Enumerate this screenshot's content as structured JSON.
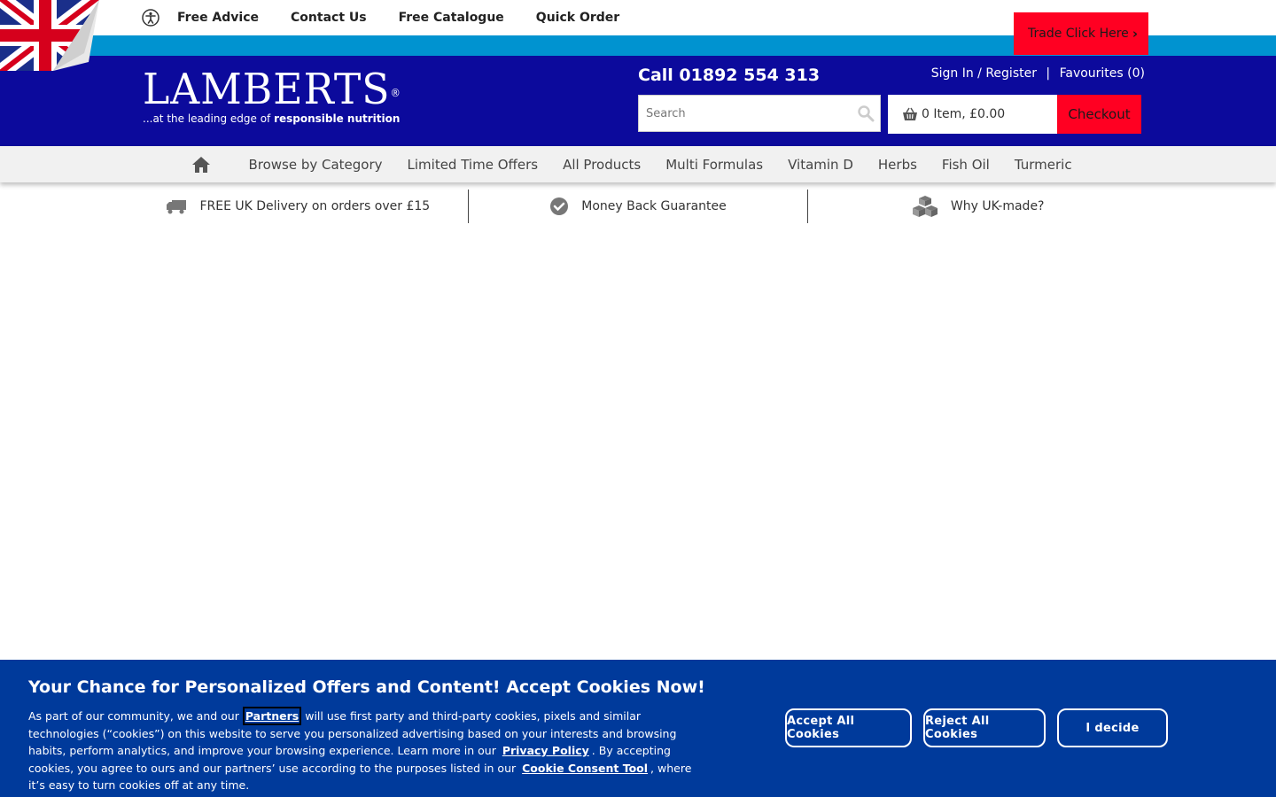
{
  "topnav": {
    "items": [
      "Free Advice",
      "Contact Us",
      "Free Catalogue",
      "Quick Order"
    ],
    "trade_label": "Trade Click Here"
  },
  "header": {
    "logo_word": "LAMBERTS",
    "logo_mark": "®",
    "logo_tag_prefix": "...at the leading edge of ",
    "logo_tag_bold": "responsible nutrition",
    "phone": "Call 01892 554 313",
    "sign_in": "Sign In / Register",
    "separator": "|",
    "favourites": "Favourites (0)",
    "search_placeholder": "Search",
    "basket": "0 Item, £0.00",
    "checkout": "Checkout"
  },
  "mainnav": {
    "items": [
      "Browse by Category",
      "Limited Time Offers",
      "All Products",
      "Multi Formulas",
      "Vitamin D",
      "Herbs",
      "Fish Oil",
      "Turmeric"
    ]
  },
  "benefits": [
    "FREE UK Delivery on orders over £15",
    "Money Back Guarantee",
    "Why UK-made?"
  ],
  "cookie": {
    "title": "Your Chance for Personalized Offers and Content! Accept Cookies Now! ",
    "text_1": "As part of our community, we and our ",
    "partners_link": "Partners",
    "text_2": " will use first party and third-party cookies, pixels and similar technologies (“cookies”) on this website to serve you personalized advertising based on your interests and browsing habits, perform analytics, and improve your browsing experience. Learn more in our ",
    "privacy_link": "Privacy Policy",
    "text_3": ". By accepting cookies, you agree to ours and our partners’ use according to the purposes listed in our ",
    "consent_link": "Cookie Consent Tool",
    "text_4": ", where it’s easy to turn cookies off at any time.",
    "accept": "Accept All Cookies",
    "reject": "Reject All Cookies",
    "decide": "I decide"
  },
  "colors": {
    "header_blue": "#0c0a9c",
    "stripe_blue": "#0093d0",
    "accent_red": "#ff0022",
    "cookie_blue": "#003a9b"
  }
}
